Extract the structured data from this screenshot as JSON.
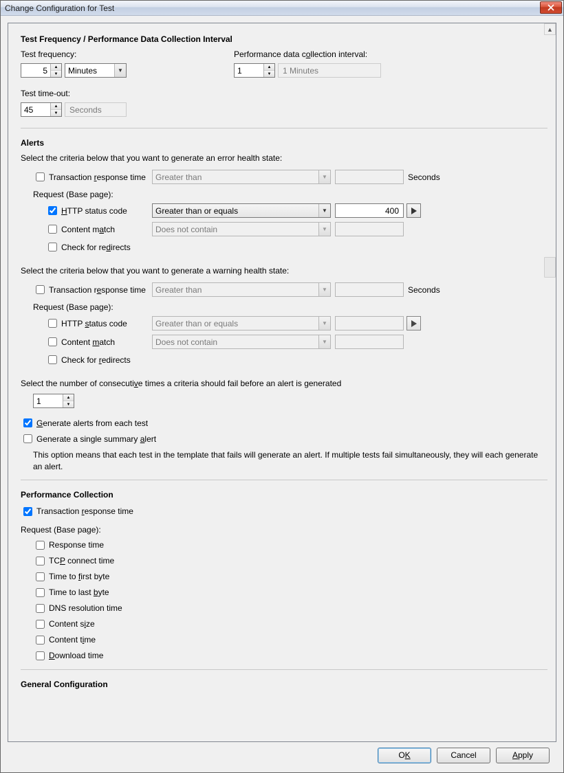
{
  "window": {
    "title": "Change Configuration for Test"
  },
  "sections": {
    "freq": {
      "title": "Test Frequency / Performance Data Collection Interval",
      "testFreqLabel": "Test frequency:",
      "testFreqValue": "5",
      "testFreqUnit": "Minutes",
      "perfLabel": "Performance data collection interval:",
      "perfValue": "1",
      "perfUnit": "1 Minutes",
      "timeoutLabel": "Test time-out:",
      "timeoutValue": "45",
      "timeoutUnit": "Seconds"
    },
    "alerts": {
      "title": "Alerts",
      "errorIntro": "Select the criteria below that you want to generate an error health state:",
      "warningIntro": "Select the criteria below that you want to generate a warning health state:",
      "consecutiveLabel": "Select the number of consecutive times a criteria should fail before an alert is generated",
      "consecutiveValue": "1",
      "trt": "Transaction response time",
      "requestBase": "Request (Base page):",
      "httpStatus": "HTTP status code",
      "contentMatch": "Content match",
      "checkRedirects": "Check for redirects",
      "opGreaterThan": "Greater than",
      "opGreaterEq": "Greater than or equals",
      "opDoesNotContain": "Does not contain",
      "errHttpValue": "400",
      "secondsUnit": "Seconds",
      "genEach": "Generate alerts from each test",
      "genSummary": "Generate a single summary alert",
      "note": "This option means that each test in the template that fails will generate an alert. If multiple tests fail simultaneously, they will each generate an alert."
    },
    "perf": {
      "title": "Performance Collection",
      "trt": "Transaction response time",
      "requestBase": "Request (Base page):",
      "items": {
        "response": "Response time",
        "tcp": "TCP connect time",
        "firstByte": "Time to first byte",
        "lastByte": "Time to last byte",
        "dns": "DNS resolution time",
        "csize": "Content size",
        "ctime": "Content time",
        "dl": "Download time"
      }
    },
    "general": {
      "title": "General Configuration"
    }
  },
  "buttons": {
    "ok": "OK",
    "cancel": "Cancel",
    "apply": "Apply"
  }
}
